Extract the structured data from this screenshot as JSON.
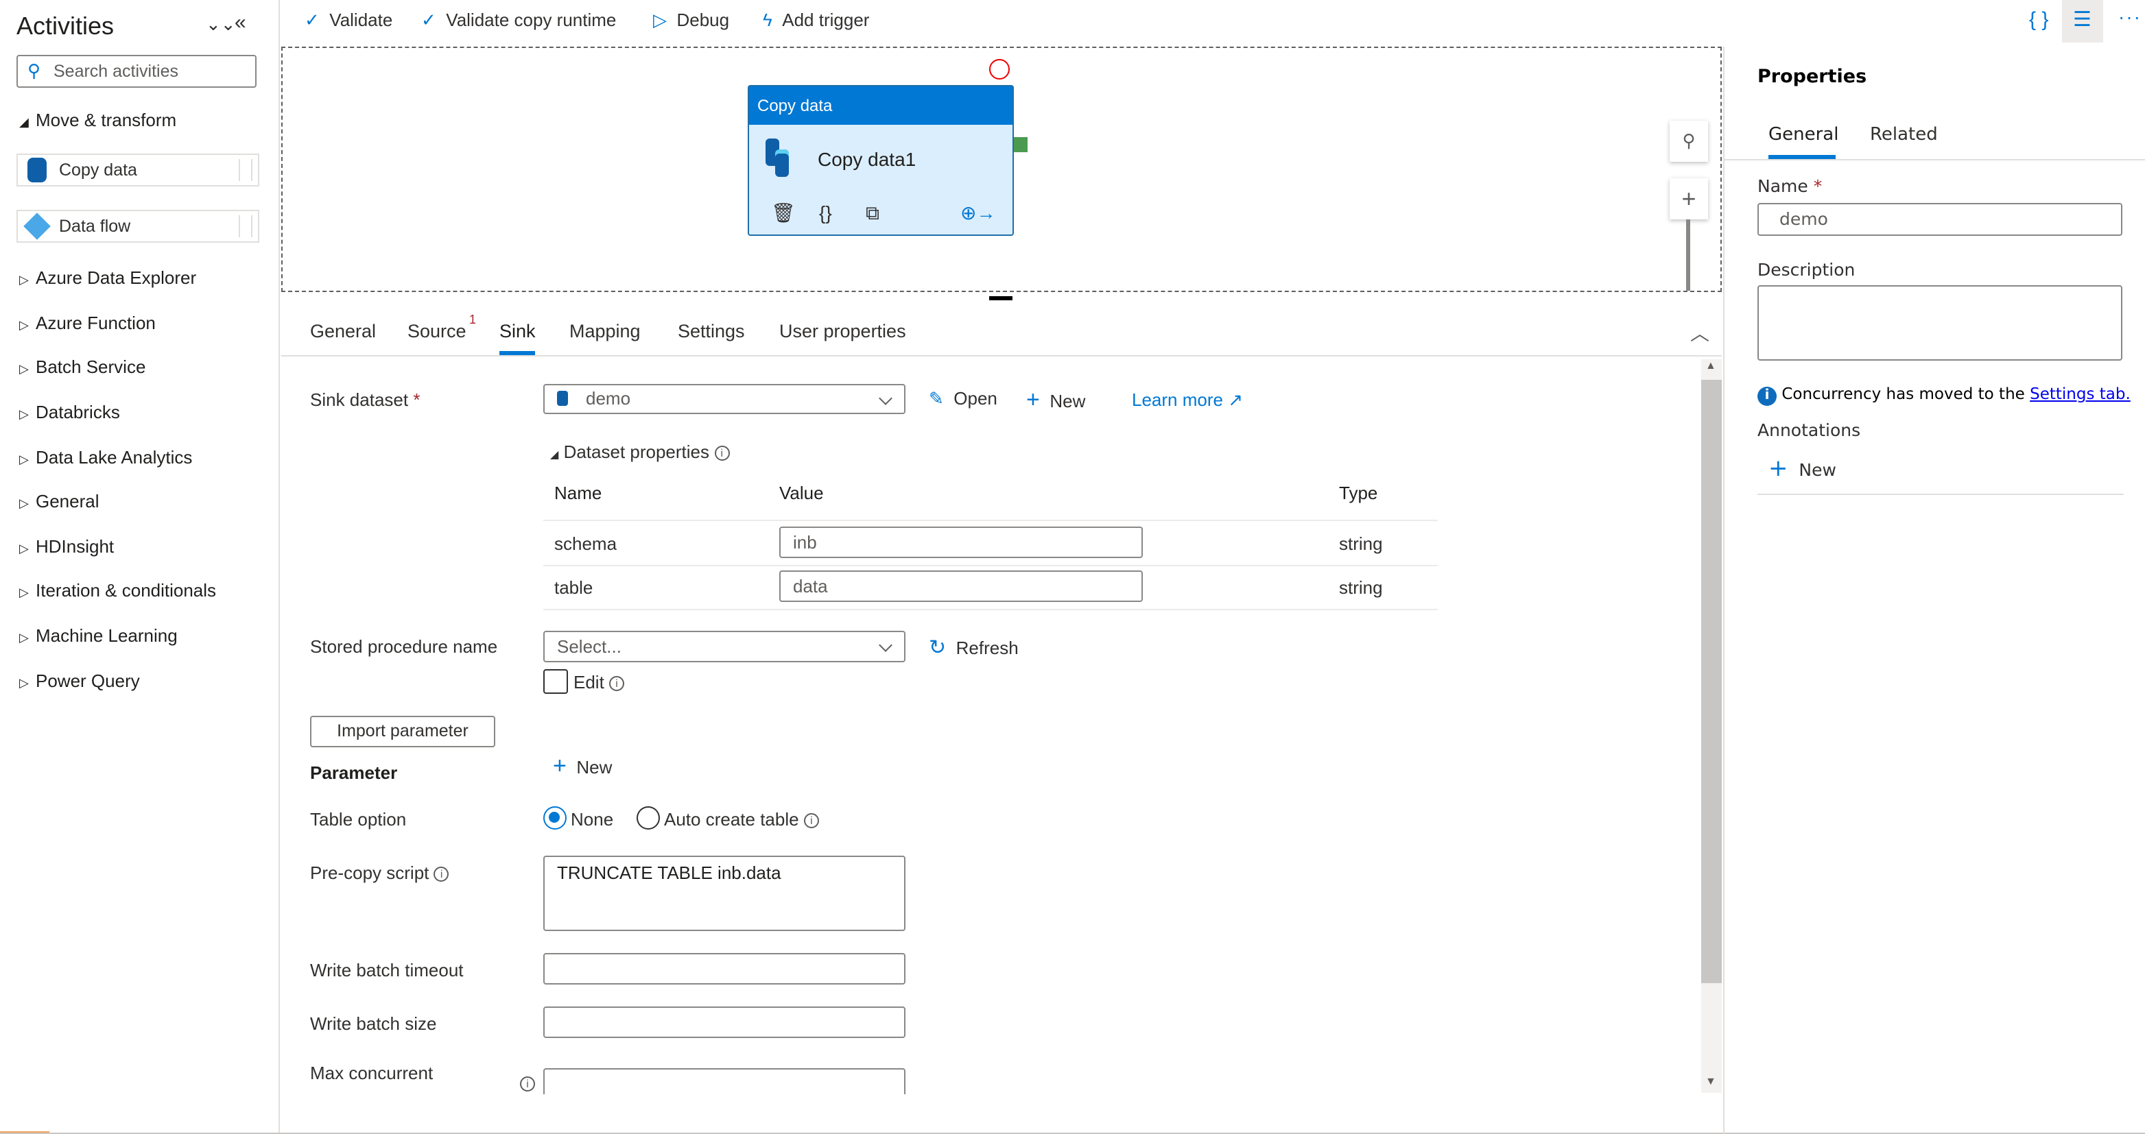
{
  "sidebar": {
    "title": "Activities",
    "search_placeholder": "Search activities",
    "group": "Move & transform",
    "activities": [
      {
        "label": "Copy data"
      },
      {
        "label": "Data flow"
      }
    ],
    "categories": [
      "Azure Data Explorer",
      "Azure Function",
      "Batch Service",
      "Databricks",
      "Data Lake Analytics",
      "General",
      "HDInsight",
      "Iteration & conditionals",
      "Machine Learning",
      "Power Query"
    ]
  },
  "toolbar": {
    "validate": "Validate",
    "validate_copy_runtime": "Validate copy runtime",
    "debug": "Debug",
    "add_trigger": "Add trigger"
  },
  "canvas": {
    "node_type": "Copy data",
    "node_name": "Copy data1"
  },
  "bottom": {
    "tabs": [
      "General",
      "Source",
      "Sink",
      "Mapping",
      "Settings",
      "User properties"
    ],
    "active_tab": "Sink",
    "source_badge": "1",
    "sink_dataset_label": "Sink dataset",
    "sink_dataset_value": "demo",
    "open": "Open",
    "new": "New",
    "learn_more": "Learn more",
    "dataset_properties": "Dataset properties",
    "columns": {
      "name": "Name",
      "value": "Value",
      "type": "Type"
    },
    "rows": [
      {
        "name": "schema",
        "value": "inb",
        "type": "string"
      },
      {
        "name": "table",
        "value": "data",
        "type": "string"
      }
    ],
    "stored_procedure_label": "Stored procedure name",
    "stored_procedure_placeholder": "Select...",
    "refresh": "Refresh",
    "edit": "Edit",
    "import_parameter": "Import parameter",
    "parameter_label": "Parameter",
    "parameter_new": "New",
    "table_option_label": "Table option",
    "table_option_none": "None",
    "table_option_auto": "Auto create table",
    "table_option_selected": "None",
    "pre_copy_label": "Pre-copy script",
    "pre_copy_value": "TRUNCATE TABLE inb.data",
    "write_batch_timeout": "Write batch timeout",
    "write_batch_size": "Write batch size",
    "max_concurrent": "Max concurrent"
  },
  "properties": {
    "title": "Properties",
    "tabs": [
      "General",
      "Related"
    ],
    "name_label": "Name",
    "name_value": "demo",
    "description_label": "Description",
    "info_text": "Concurrency has moved to the ",
    "info_link": "Settings tab.",
    "annotations": "Annotations",
    "new": "New"
  },
  "colors": {
    "accent": "#0078d4",
    "required": "#a4262c",
    "node_bg": "#dbeefd",
    "success_port": "#4c9a50"
  }
}
